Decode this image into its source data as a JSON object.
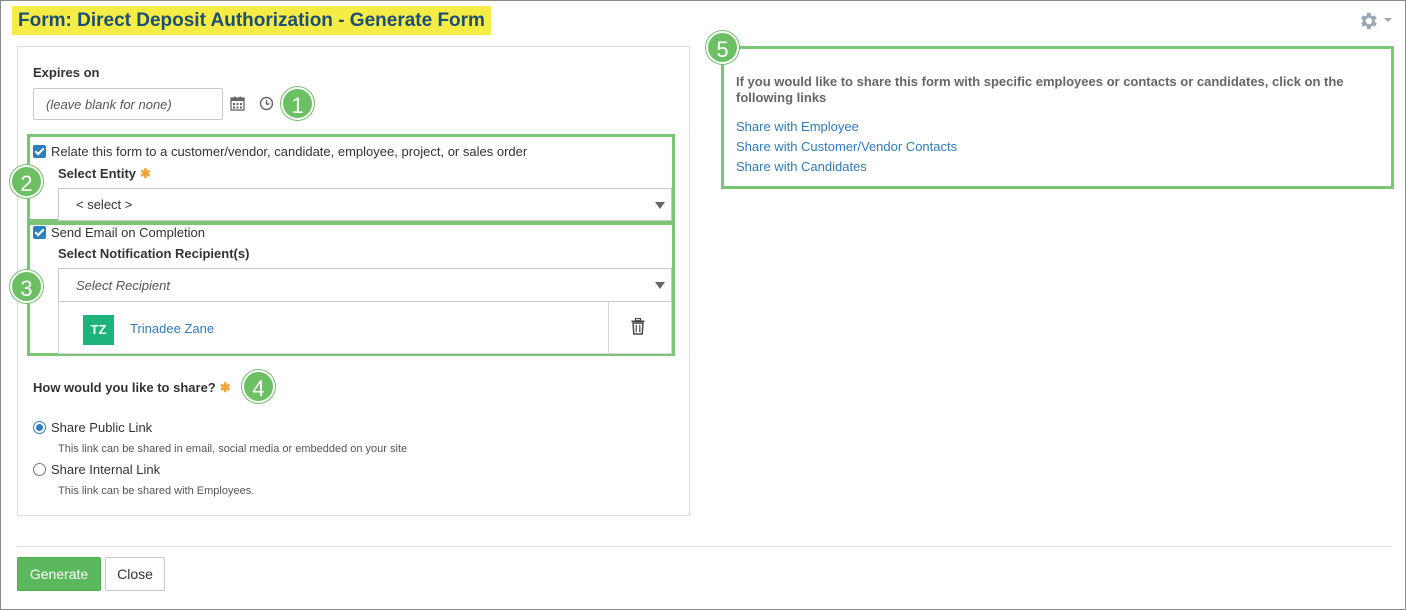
{
  "header": {
    "title": "Form: Direct Deposit Authorization - Generate Form",
    "settings_icon": "gear-icon"
  },
  "expires": {
    "label": "Expires on",
    "placeholder": "(leave blank for none)",
    "calendar_icon": "calendar-icon",
    "clock_icon": "clock-icon"
  },
  "relate": {
    "checkbox_label": "Relate this form to a customer/vendor, candidate, employee, project, or sales order",
    "checked": true,
    "entity_label": "Select Entity",
    "required_mark": "✱",
    "entity_value": "< select >"
  },
  "notify": {
    "checkbox_label": "Send Email on Completion",
    "checked": true,
    "recipients_label": "Select Notification Recipient(s)",
    "recipient_placeholder": "Select Recipient",
    "recipients": [
      {
        "initials": "TZ",
        "name": "Trinadee Zane"
      }
    ]
  },
  "share": {
    "question": "How would you like to share?",
    "required_mark": "✱",
    "options": [
      {
        "label": "Share Public Link",
        "hint": "This link can be shared in email, social media or embedded on your site",
        "selected": true
      },
      {
        "label": "Share Internal Link",
        "hint": "This link can be shared with Employees.",
        "selected": false
      }
    ]
  },
  "share_panel": {
    "text": "If you would like to share this form with specific employees or contacts or candidates, click on the following links",
    "links": [
      "Share with Employee",
      "Share with Customer/Vendor Contacts",
      "Share with Candidates"
    ]
  },
  "callouts": [
    "1",
    "2",
    "3",
    "4",
    "5"
  ],
  "footer": {
    "generate_label": "Generate",
    "close_label": "Close"
  },
  "colors": {
    "title_highlight": "#f5ec45",
    "title_text": "#1d4f74",
    "callout_green": "#6cbf63",
    "link_blue": "#2e7bbf",
    "generate_green": "#5cb85c",
    "avatar_green": "#1eb37a"
  }
}
